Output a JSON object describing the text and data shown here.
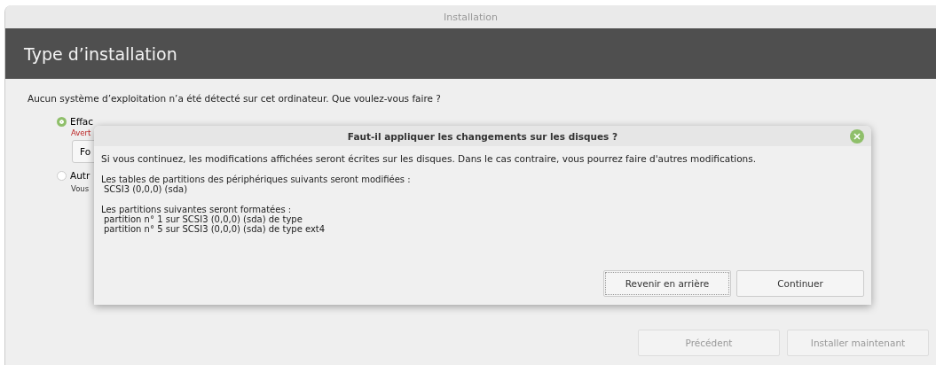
{
  "window": {
    "title": "Installation"
  },
  "header": {
    "title": "Type d’installation"
  },
  "question": "Aucun système d’exploitation n’a été détecté sur cet ordinateur. Que voulez-vous faire ?",
  "options": [
    {
      "label": "Effac",
      "selected": true,
      "warning": "Avert",
      "field": "Fo"
    },
    {
      "label": "Autr",
      "selected": false,
      "note": "Vous"
    }
  ],
  "buttons": [
    {
      "label": "Précédent",
      "disabled": true
    },
    {
      "label": "Installer maintenant",
      "disabled": true
    }
  ],
  "dialog": {
    "title": "Faut-il appliquer les changements sur les disques ?",
    "intro": "Si vous continuez, les modifications affichées seront écrites sur les disques. Dans le cas contraire, vous pourrez faire d'autres modifications.",
    "sections": [
      {
        "heading": "Les tables de partitions des périphériques suivants seront modifiées :",
        "lines": [
          "SCSI3 (0,0,0) (sda)"
        ]
      },
      {
        "heading": "Les partitions suivantes seront formatées :",
        "lines": [
          "partition n° 1 sur SCSI3 (0,0,0) (sda) de type",
          "partition n° 5 sur SCSI3 (0,0,0) (sda) de type ext4"
        ]
      }
    ],
    "buttons": [
      {
        "label": "Revenir en arrière",
        "focused": true
      },
      {
        "label": "Continuer",
        "focused": false
      }
    ]
  }
}
